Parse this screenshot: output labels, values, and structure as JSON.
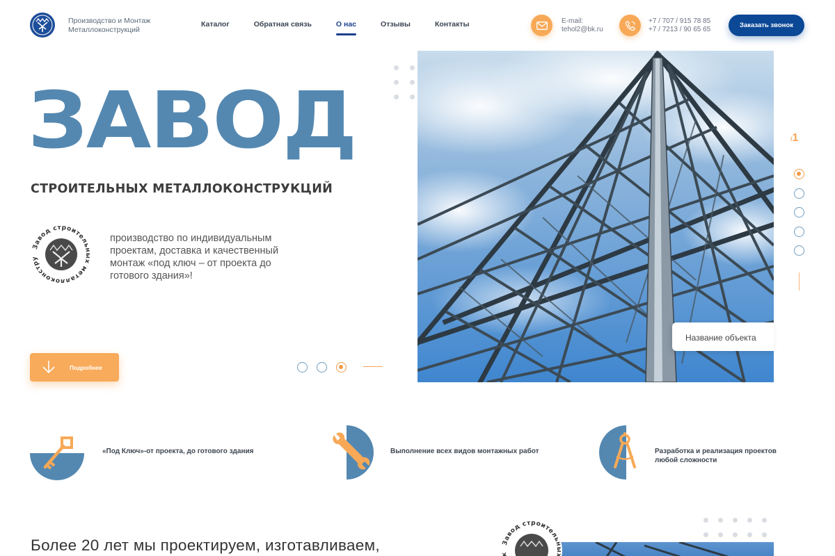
{
  "header": {
    "logo_line1": "Производство и Монтаж",
    "logo_line2": "Металлоконструкций",
    "nav": [
      {
        "label": "Каталог"
      },
      {
        "label": "Обратная связь"
      },
      {
        "label": "О нас"
      },
      {
        "label": "Отзывы"
      },
      {
        "label": "Контакты"
      }
    ],
    "active_nav": "О нас",
    "email_label": "E-mail:",
    "email": "tehol2@bk.ru",
    "phone1": "+7 / 707 / 915 78 85",
    "phone2": "+7 / 7213 / 90 65 65",
    "call_button": "Заказать звонок"
  },
  "hero": {
    "title": "ЗАВОД",
    "subtitle": "СТРОИТЕЛЬНЫХ МЕТАЛЛОКОНСТРУКЦИЙ",
    "description": "производство по индивидуальным проектам,  доставка и качественный монтаж «под ключ  – от проекта до готового здания»!",
    "seal_text": "Завод строительных металлоконструкций",
    "more_button": "Подробнее",
    "object_label": "Название объекта",
    "slide_dots_active": 3,
    "slide_dots_total": 3
  },
  "counter": {
    "current": "/",
    "total": "1"
  },
  "side_nav": {
    "active": 1,
    "total": 5
  },
  "features": [
    {
      "text": "«Под Ключ»-от проекта, до готового здания",
      "icon": "key-icon"
    },
    {
      "text": "Выполнение всех видов монтажных работ",
      "icon": "wrench-icon"
    },
    {
      "text_line1": "Разработка и реализация проектов",
      "text_line2": "любой сложности",
      "icon": "compass-icon"
    }
  ],
  "about": {
    "intro": "Более 20 лет мы проектируем, изготавливаем,"
  },
  "colors": {
    "brand_blue": "#0b4896",
    "steel_blue": "#5488b1",
    "accent_orange": "#f7a957"
  }
}
